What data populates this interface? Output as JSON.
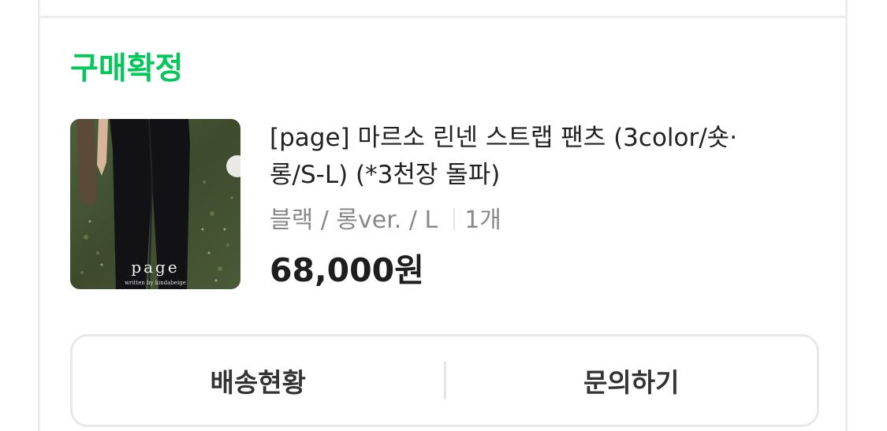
{
  "order": {
    "status_label": "구매확정",
    "status_color": "#03c75a"
  },
  "product": {
    "title_line1": "[page] 마르소 린넨 스트랩 팬츠 (3color/숏·",
    "title_line2": "롱/S-L) (*3천장 돌파)",
    "option_text": "블랙 / 롱ver. / L",
    "quantity_text": "1개",
    "price_text": "68,000원",
    "thumbnail_brand_text": "page",
    "thumbnail_sub_text": "written by kindabeige"
  },
  "actions": {
    "shipping_status_label": "배송현황",
    "inquiry_label": "문의하기"
  }
}
